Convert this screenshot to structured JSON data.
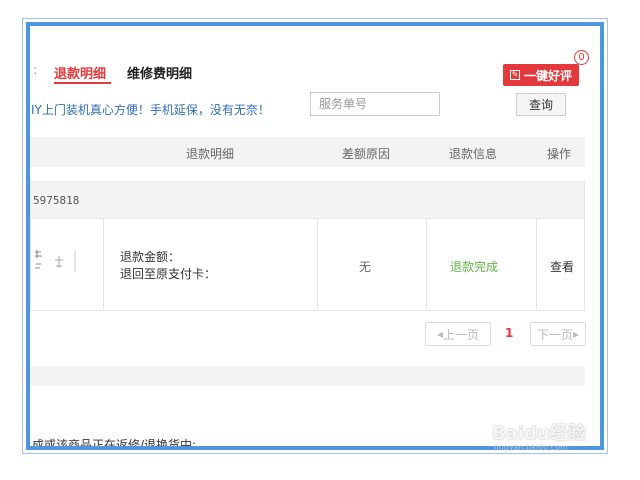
{
  "tabs": {
    "edge_fragment": "",
    "refund": "退款明细",
    "repair": "维修费明细"
  },
  "review_button": {
    "label": "一键好评",
    "badge": "0"
  },
  "promo_text": "IY上门装机真心方便！手机延保，没有无奈！",
  "search": {
    "placeholder": "服务单号",
    "button": "查询"
  },
  "table": {
    "headers": [
      "退款明细",
      "差额原因",
      "退款信息",
      "操作"
    ]
  },
  "order": {
    "number_fragment": "5975818"
  },
  "row": {
    "amount_label": "退款金额：",
    "card_label": "退回至原支付卡：",
    "reason": "无",
    "status": "退款完成",
    "action": "查看"
  },
  "pagination": {
    "prev": "上一页",
    "current": "1",
    "next": "下一页"
  },
  "bottom_note": "成或该商品正在返修/退换货中:",
  "watermark": {
    "text": "Baidu经验",
    "url": "jingyan.baidu.com"
  },
  "colors": {
    "accent": "#e4393c",
    "frame": "#4f96e0",
    "status_done": "#5fb341",
    "link_blue": "#2f6eb5"
  }
}
